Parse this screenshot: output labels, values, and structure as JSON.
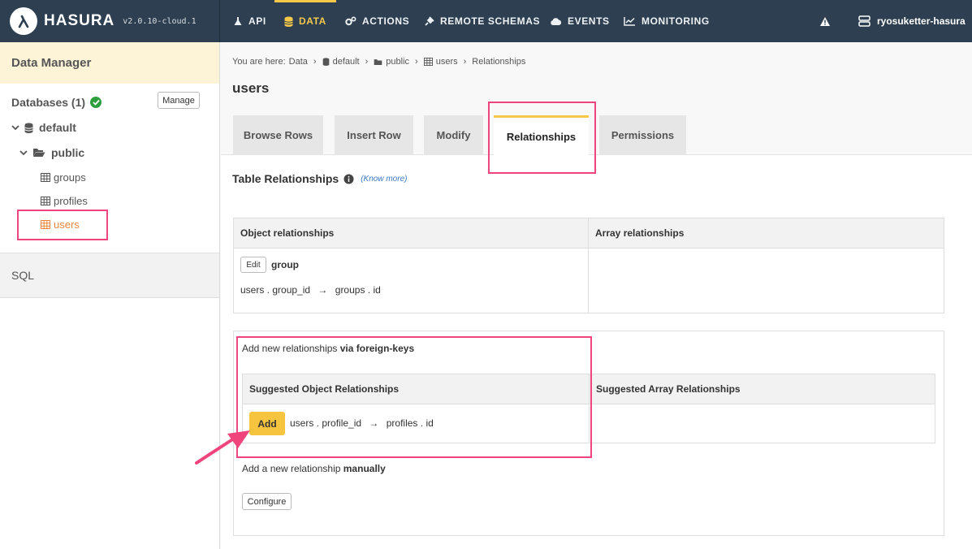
{
  "topnav": {
    "brand": "HASURA",
    "version": "v2.0.10-cloud.1",
    "items": [
      {
        "label": "API",
        "icon": "flask-icon"
      },
      {
        "label": "DATA",
        "icon": "database-icon",
        "active": true
      },
      {
        "label": "ACTIONS",
        "icon": "cogs-icon"
      },
      {
        "label": "REMOTE SCHEMAS",
        "icon": "plug-icon"
      },
      {
        "label": "EVENTS",
        "icon": "cloud-icon"
      },
      {
        "label": "MONITORING",
        "icon": "line-chart-icon"
      }
    ],
    "alert_icon": "warning-icon",
    "project": "ryosuketter-hasura"
  },
  "sidebar": {
    "header": "Data Manager",
    "databases_label": "Databases (1)",
    "manage_label": "Manage",
    "db_name": "default",
    "schema_name": "public",
    "tables": [
      "groups",
      "profiles",
      "users"
    ],
    "selected_table": "users",
    "sql_label": "SQL"
  },
  "breadcrumb": {
    "prefix": "You are here:",
    "items": [
      "Data",
      "default",
      "public",
      "users",
      "Relationships"
    ]
  },
  "page": {
    "title": "users",
    "tabs": [
      "Browse Rows",
      "Insert Row",
      "Modify",
      "Relationships",
      "Permissions"
    ],
    "active_tab": "Relationships",
    "section_title": "Table Relationships",
    "know_more": "(Know more)"
  },
  "relationships": {
    "object_header": "Object relationships",
    "array_header": "Array relationships",
    "edit_label": "Edit",
    "object_items": [
      {
        "name": "group",
        "from_table": "users",
        "from_col": "group_id",
        "to_table": "groups",
        "to_col": "id"
      }
    ]
  },
  "add_new": {
    "title_prefix": "Add new relationships",
    "title_bold": "via foreign-keys",
    "sugg_object_header": "Suggested Object Relationships",
    "sugg_array_header": "Suggested Array Relationships",
    "add_label": "Add",
    "suggestion": {
      "from_table": "users",
      "from_col": "profile_id",
      "to_table": "profiles",
      "to_col": "id"
    },
    "manual_prefix": "Add a new relationship",
    "manual_bold": "manually",
    "configure_label": "Configure"
  },
  "colors": {
    "nav_bg": "#2d3f50",
    "accent": "#f5c84a",
    "highlight": "#f0457c",
    "selected_table": "#e8863f"
  }
}
